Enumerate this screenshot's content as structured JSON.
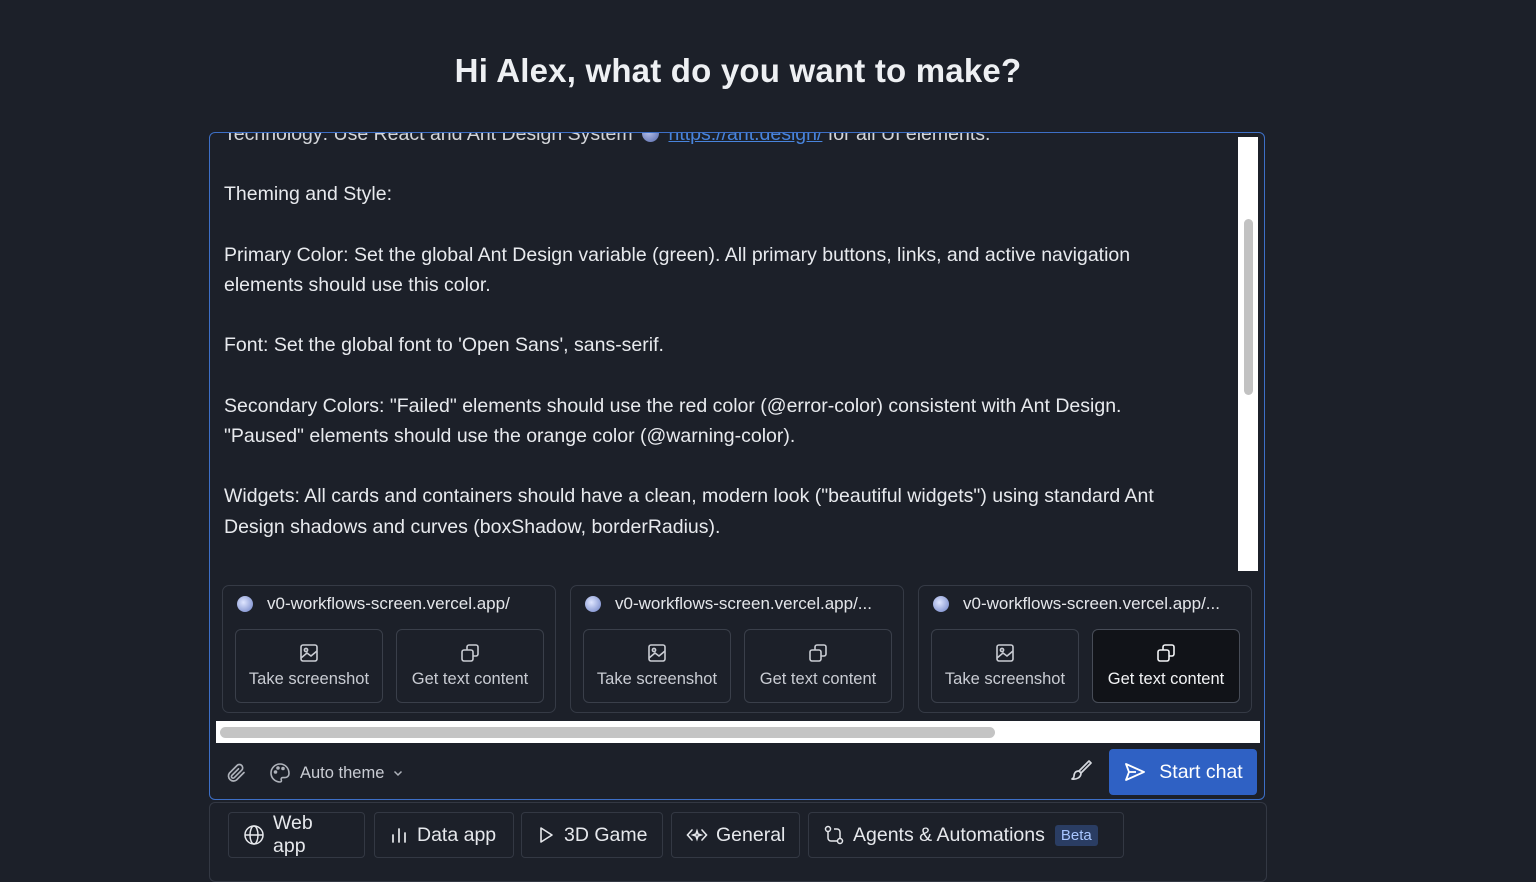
{
  "heading": "Hi Alex, what do you want to make?",
  "prompt": {
    "cut_line_prefix": "Technology: Use React and Ant Design System",
    "cut_line_link": "https://ant.design/",
    "cut_line_suffix": "for all UI elements.",
    "lines": [
      "Theming and Style:",
      "",
      "Primary Color: Set the global Ant Design variable (green). All primary buttons, links, and active navigation",
      "elements should use this color.",
      "",
      "Font: Set the global font to 'Open Sans', sans-serif.",
      "",
      "Secondary Colors: \"Failed\" elements should use the red color (@error-color) consistent with Ant Design.",
      "\"Paused\" elements should use the orange color (@warning-color).",
      "",
      "Widgets: All cards and containers should have a clean, modern look (\"beautiful widgets\") using standard Ant",
      "Design shadows and curves (boxShadow, borderRadius)."
    ]
  },
  "attachments": [
    {
      "url": "v0-workflows-screen.vercel.app/",
      "screenshot_label": "Take screenshot",
      "text_label": "Get text content",
      "text_active": false
    },
    {
      "url": "v0-workflows-screen.vercel.app/...",
      "screenshot_label": "Take screenshot",
      "text_label": "Get text content",
      "text_active": false
    },
    {
      "url": "v0-workflows-screen.vercel.app/...",
      "screenshot_label": "Take screenshot",
      "text_label": "Get text content",
      "text_active": true
    }
  ],
  "toolbar": {
    "theme_label": "Auto theme",
    "start_label": "Start chat"
  },
  "categories": [
    {
      "label": "Web app",
      "icon": "globe-icon"
    },
    {
      "label": "Data app",
      "icon": "bar-chart-icon"
    },
    {
      "label": "3D Game",
      "icon": "play-icon"
    },
    {
      "label": "General",
      "icon": "code-sparkle-icon"
    },
    {
      "label": "Agents & Automations",
      "icon": "workflow-icon",
      "badge": "Beta"
    }
  ],
  "colors": {
    "background": "#1c2029",
    "accent": "#2f61c4",
    "focus_border": "#3d6fc6",
    "link": "#4d8ff0"
  }
}
